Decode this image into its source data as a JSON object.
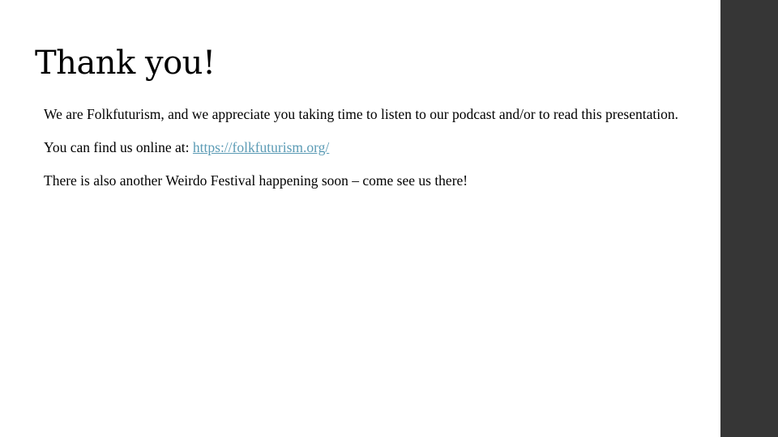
{
  "slide": {
    "title": "Thank you!",
    "paragraph_1": "We are Folkfuturism, and we appreciate you taking time to listen to our podcast and/or to read this presentation.",
    "paragraph_2_prefix": "You can find us online at: ",
    "link_text": "https://folkfuturism.org/",
    "paragraph_3": "There is also another Weirdo Festival happening soon – come see us there!"
  },
  "colors": {
    "background": "#ffffff",
    "side_bar": "#363636",
    "text": "#000000",
    "link": "#5b9bb5"
  }
}
